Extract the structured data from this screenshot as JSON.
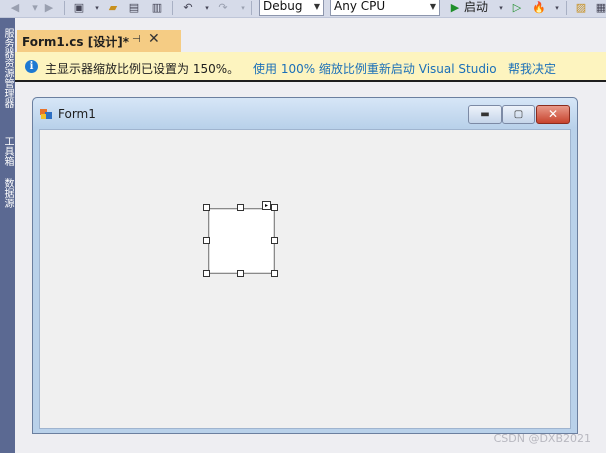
{
  "toolbar": {
    "configuration": "Debug",
    "platform": "Any CPU",
    "start_label": "启动"
  },
  "sidebar": {
    "tabs": [
      "服务器资源管理器",
      "工具箱",
      "数据源"
    ]
  },
  "document_tab": {
    "title": "Form1.cs [设计]*",
    "pin_glyph": "⊣",
    "close_glyph": "✕"
  },
  "info_bar": {
    "message": "主显示器缩放比例已设置为 150%。",
    "restart_link": "使用 100% 缩放比例重新启动 Visual Studio",
    "help_link": "帮我决定"
  },
  "form": {
    "title": "Form1",
    "minimize_glyph": "▬",
    "maximize_glyph": "▢",
    "close_glyph": "✕"
  },
  "watermark": "CSDN @DXB2021",
  "colors": {
    "tab_accent": "#f5cc84",
    "infobar_bg": "#fdf4bf",
    "link": "#1a6fb8",
    "sidebar": "#5b6992"
  }
}
